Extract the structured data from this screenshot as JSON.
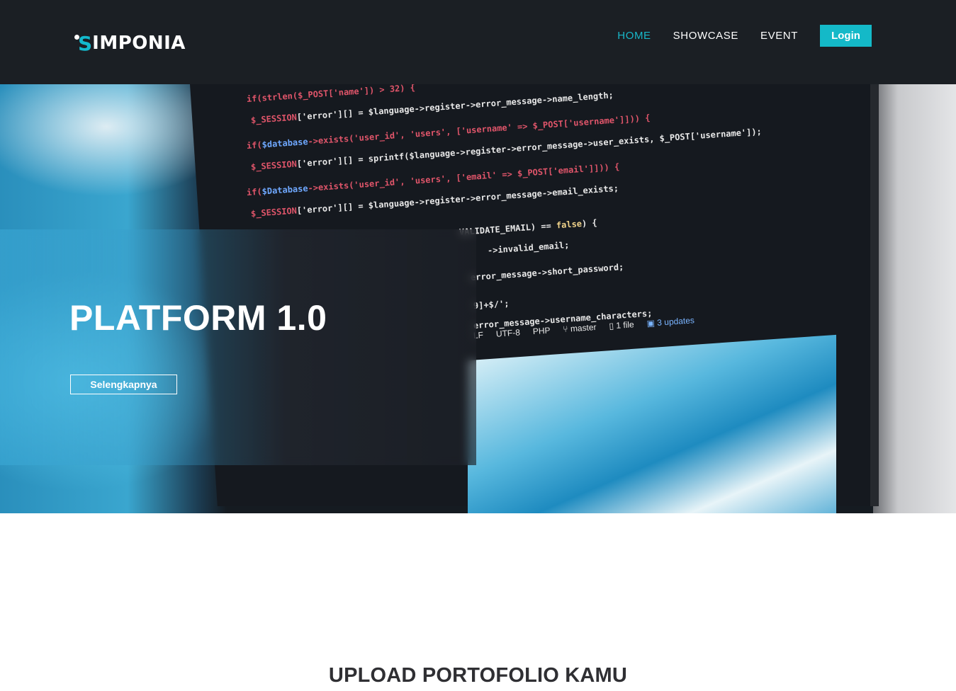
{
  "header": {
    "logo": {
      "s": "S",
      "rest": "IMPONIA"
    },
    "nav": [
      {
        "label": "HOME",
        "active": true
      },
      {
        "label": "SHOWCASE",
        "active": false
      },
      {
        "label": "EVENT",
        "active": false
      }
    ],
    "login_label": "Login"
  },
  "hero": {
    "title": "PLATFORM 1.0",
    "button_label": "Selengkapnya",
    "statusbar": {
      "line_ending": "LF",
      "encoding": "UTF-8",
      "language": "PHP",
      "branch": "master",
      "files": "1 file",
      "updates": "3 updates"
    }
  },
  "section": {
    "heading": "UPLOAD PORTOFOLIO KAMU"
  },
  "colors": {
    "navbar_bg": "#1b1f24",
    "accent": "#14b9c8",
    "heading_text": "#2f2f33"
  }
}
